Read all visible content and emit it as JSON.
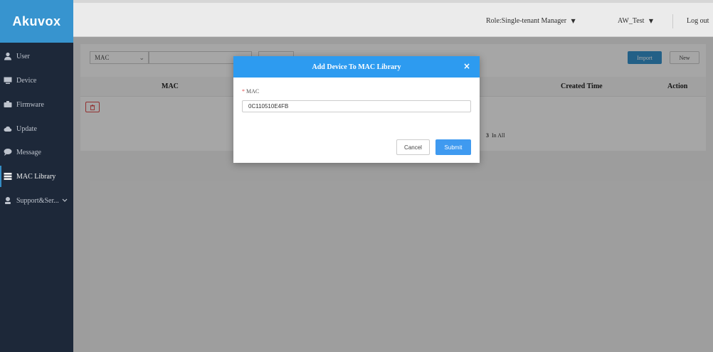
{
  "app": {
    "brand": "Akuvox"
  },
  "sidebar": {
    "items": [
      {
        "label": "User",
        "icon": "user-icon"
      },
      {
        "label": "Device",
        "icon": "device-icon"
      },
      {
        "label": "Firmware",
        "icon": "firmware-icon"
      },
      {
        "label": "Update",
        "icon": "cloud-icon"
      },
      {
        "label": "Message",
        "icon": "message-icon"
      },
      {
        "label": "MAC Library",
        "icon": "library-icon",
        "active": true
      },
      {
        "label": "Support&Ser...",
        "icon": "support-icon"
      }
    ]
  },
  "header": {
    "role": "Role:Single-tenant Manager",
    "account": "AW_Test",
    "logout": "Log out"
  },
  "toolbar": {
    "filter_value": "MAC",
    "import_label": "Import",
    "new_label": "New"
  },
  "table": {
    "columns": {
      "mac": "MAC",
      "created_time": "Created Time",
      "action": "Action"
    }
  },
  "pagination": {
    "total": "3",
    "suffix": "In All"
  },
  "dialog": {
    "title": "Add Device To MAC Library",
    "close_glyph": "×",
    "field_required_mark": "*",
    "field_label": "MAC",
    "field_value": "0C110510E4FB",
    "cancel_label": "Cancel",
    "submit_label": "Submit"
  },
  "colors": {
    "sidebar_bg": "#1f2b3d",
    "brand_blue": "#3794cf",
    "dialog_header": "#2d9bf0",
    "danger": "#e04a4a"
  }
}
